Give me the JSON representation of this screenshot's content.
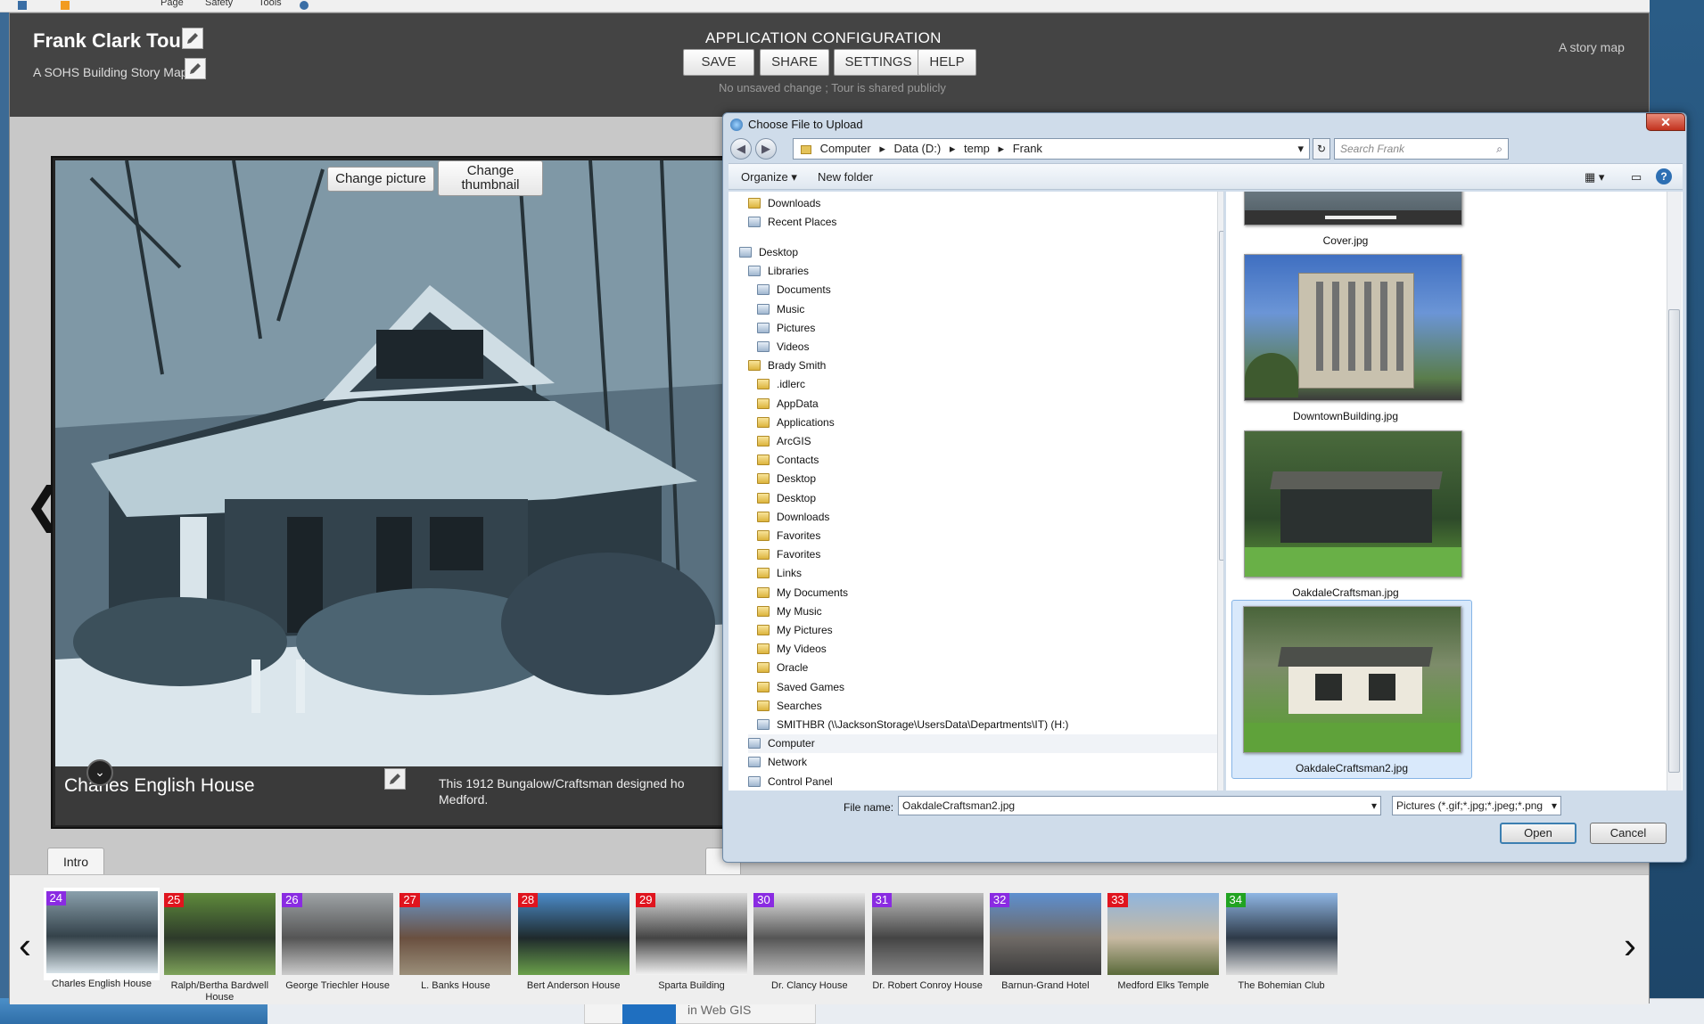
{
  "browser": {
    "commands": [
      "Page",
      "Safety",
      "Tools"
    ]
  },
  "header": {
    "title": "Frank Clark Tour",
    "subtitle": "A SOHS Building Story Map",
    "config_title": "APPLICATION CONFIGURATION",
    "buttons": {
      "save": "SAVE",
      "share": "SHARE",
      "settings": "SETTINGS",
      "help": "HELP"
    },
    "status": "No unsaved change ; Tour is shared publicly",
    "story_map_label": "A story map"
  },
  "photo": {
    "change_picture": "Change picture",
    "change_thumbnail_line1": "Change",
    "change_thumbnail_line2": "thumbnail",
    "caption_title": "Charles English House",
    "caption_text_line1": "This 1912 Bungalow/Craftsman designed ho",
    "caption_text_line2": "Medford."
  },
  "tabs": {
    "intro": "Intro"
  },
  "carousel": {
    "items": [
      {
        "num": "24",
        "label": "Charles English House",
        "color": "#8a2be2"
      },
      {
        "num": "25",
        "label": "Ralph/Bertha Bardwell House",
        "color": "#e0141e"
      },
      {
        "num": "26",
        "label": "George Triechler House",
        "color": "#8a2be2"
      },
      {
        "num": "27",
        "label": "L. Banks House",
        "color": "#e0141e"
      },
      {
        "num": "28",
        "label": "Bert Anderson House",
        "color": "#e0141e"
      },
      {
        "num": "29",
        "label": "Sparta Building",
        "color": "#e0141e"
      },
      {
        "num": "30",
        "label": "Dr. Clancy House",
        "color": "#8a2be2"
      },
      {
        "num": "31",
        "label": "Dr. Robert Conroy House",
        "color": "#8a2be2"
      },
      {
        "num": "32",
        "label": "Barnun-Grand Hotel",
        "color": "#8a2be2"
      },
      {
        "num": "33",
        "label": "Medford Elks Temple",
        "color": "#e0141e"
      },
      {
        "num": "34",
        "label": "The Bohemian Club",
        "color": "#21a321"
      }
    ]
  },
  "dialog": {
    "title": "Choose File to Upload",
    "path": [
      "Computer",
      "Data (D:)",
      "temp",
      "Frank"
    ],
    "search_placeholder": "Search Frank",
    "organize": "Organize",
    "new_folder": "New folder",
    "tree": [
      {
        "label": "Downloads",
        "indent": 1,
        "kind": "folder"
      },
      {
        "label": "Recent Places",
        "indent": 1,
        "kind": "special"
      },
      {
        "label": "",
        "indent": 0,
        "kind": "spacer"
      },
      {
        "label": "Desktop",
        "indent": 0,
        "kind": "special"
      },
      {
        "label": "Libraries",
        "indent": 1,
        "kind": "special"
      },
      {
        "label": "Documents",
        "indent": 2,
        "kind": "special"
      },
      {
        "label": "Music",
        "indent": 2,
        "kind": "special"
      },
      {
        "label": "Pictures",
        "indent": 2,
        "kind": "special"
      },
      {
        "label": "Videos",
        "indent": 2,
        "kind": "special"
      },
      {
        "label": "Brady Smith",
        "indent": 1,
        "kind": "folder"
      },
      {
        "label": ".idlerc",
        "indent": 2,
        "kind": "folder"
      },
      {
        "label": "AppData",
        "indent": 2,
        "kind": "folder"
      },
      {
        "label": "Applications",
        "indent": 2,
        "kind": "folder"
      },
      {
        "label": "ArcGIS",
        "indent": 2,
        "kind": "folder"
      },
      {
        "label": "Contacts",
        "indent": 2,
        "kind": "folder"
      },
      {
        "label": "Desktop",
        "indent": 2,
        "kind": "folder"
      },
      {
        "label": "Desktop",
        "indent": 2,
        "kind": "folder"
      },
      {
        "label": "Downloads",
        "indent": 2,
        "kind": "folder"
      },
      {
        "label": "Favorites",
        "indent": 2,
        "kind": "folder"
      },
      {
        "label": "Favorites",
        "indent": 2,
        "kind": "folder"
      },
      {
        "label": "Links",
        "indent": 2,
        "kind": "folder"
      },
      {
        "label": "My Documents",
        "indent": 2,
        "kind": "folder"
      },
      {
        "label": "My Music",
        "indent": 2,
        "kind": "folder"
      },
      {
        "label": "My Pictures",
        "indent": 2,
        "kind": "folder"
      },
      {
        "label": "My Videos",
        "indent": 2,
        "kind": "folder"
      },
      {
        "label": "Oracle",
        "indent": 2,
        "kind": "folder"
      },
      {
        "label": "Saved Games",
        "indent": 2,
        "kind": "folder"
      },
      {
        "label": "Searches",
        "indent": 2,
        "kind": "folder"
      },
      {
        "label": "SMITHBR (\\\\JacksonStorage\\UsersData\\Departments\\IT) (H:)",
        "indent": 2,
        "kind": "special"
      },
      {
        "label": "Computer",
        "indent": 1,
        "kind": "special"
      },
      {
        "label": "Network",
        "indent": 1,
        "kind": "special"
      },
      {
        "label": "Control Panel",
        "indent": 1,
        "kind": "special"
      }
    ],
    "files": [
      {
        "name": "Cover.jpg"
      },
      {
        "name": "DowntownBuilding.jpg"
      },
      {
        "name": "OakdaleCraftsman.jpg"
      },
      {
        "name": "OakdaleCraftsman2.jpg"
      }
    ],
    "file_name_label": "File name:",
    "file_name_value": "OakdaleCraftsman2.jpg",
    "file_type": "Pictures (*.gif;*.jpg;*.jpeg;*.png",
    "open": "Open",
    "cancel": "Cancel"
  },
  "taskbar": {
    "web_gis_label": "in Web GIS"
  }
}
